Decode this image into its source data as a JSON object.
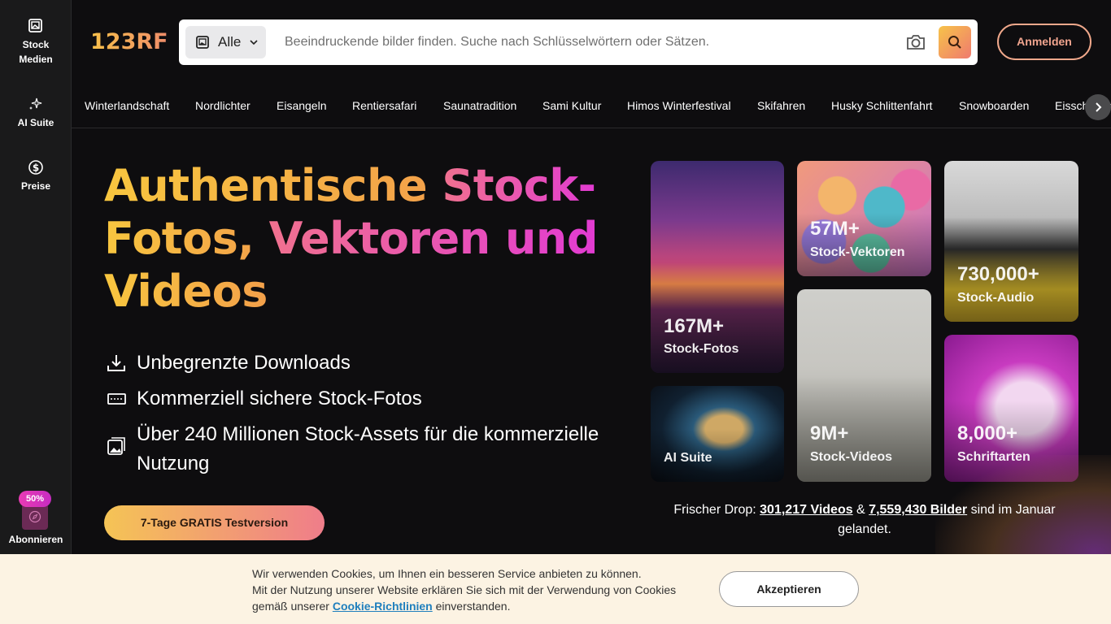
{
  "sidebar": {
    "items": [
      {
        "label": "Stock Medien",
        "icon": "stock-media-icon"
      },
      {
        "label": "AI Suite",
        "icon": "sparkles-icon"
      },
      {
        "label": "Preise",
        "icon": "dollar-icon"
      }
    ],
    "subscribe": {
      "badge": "50%",
      "label": "Abonnieren",
      "icon": "compass-icon"
    }
  },
  "header": {
    "logo": "123RF",
    "search": {
      "type_label": "Alle",
      "placeholder": "Beeindruckende bilder finden. Suche nach Schlüsselwörtern oder Sätzen."
    },
    "login_label": "Anmelden"
  },
  "tags": [
    "Winterlandschaft",
    "Nordlichter",
    "Eisangeln",
    "Rentiersafari",
    "Saunatradition",
    "Sami Kultur",
    "Himos Winterfestival",
    "Skifahren",
    "Husky Schlittenfahrt",
    "Snowboarden",
    "Eisschwimmen"
  ],
  "hero": {
    "title_part1": "Authentische ",
    "title_part2": "Stock-",
    "title_part3": "Fotos, ",
    "title_part4": "Vektoren und",
    "title_part5": "Videos",
    "features": [
      {
        "icon": "download-icon",
        "text": "Unbegrenzte Downloads"
      },
      {
        "icon": "ticket-icon",
        "text": "Kommerziell sichere Stock-Fotos"
      },
      {
        "icon": "images-icon",
        "text": "Über 240 Millionen Stock-Assets für die kommerzielle Nutzung"
      }
    ],
    "cta_label": "7-Tage GRATIS Testversion"
  },
  "cards": {
    "photos": {
      "count": "167M+",
      "label": "Stock-Fotos"
    },
    "vectors": {
      "count": "57M+",
      "label": "Stock-Vektoren"
    },
    "audio": {
      "count": "730,000+",
      "label": "Stock-Audio"
    },
    "ai": {
      "label": "AI Suite"
    },
    "videos": {
      "count": "9M+",
      "label": "Stock-Videos"
    },
    "fonts": {
      "count": "8,000+",
      "label": "Schriftarten"
    }
  },
  "fresh_drop": {
    "prefix": "Frischer Drop: ",
    "videos": "301,217 Videos",
    "amp": " & ",
    "images": "7,559,430 Bilder",
    "suffix": " sind im Januar gelandet."
  },
  "cookie": {
    "line1": "Wir verwenden Cookies, um Ihnen ein besseren Service anbieten zu können.",
    "line2": "Mit der Nutzung unserer Website erklären Sie sich mit der Verwendung von Cookies gemäß unserer ",
    "link": "Cookie-Richtlinien",
    "line3": " einverstanden.",
    "accept_label": "Akzeptieren"
  },
  "colors": {
    "accent_yellow": "#f7c640",
    "accent_pink": "#e23bd2",
    "cookie_bg": "#fcf3e3"
  }
}
